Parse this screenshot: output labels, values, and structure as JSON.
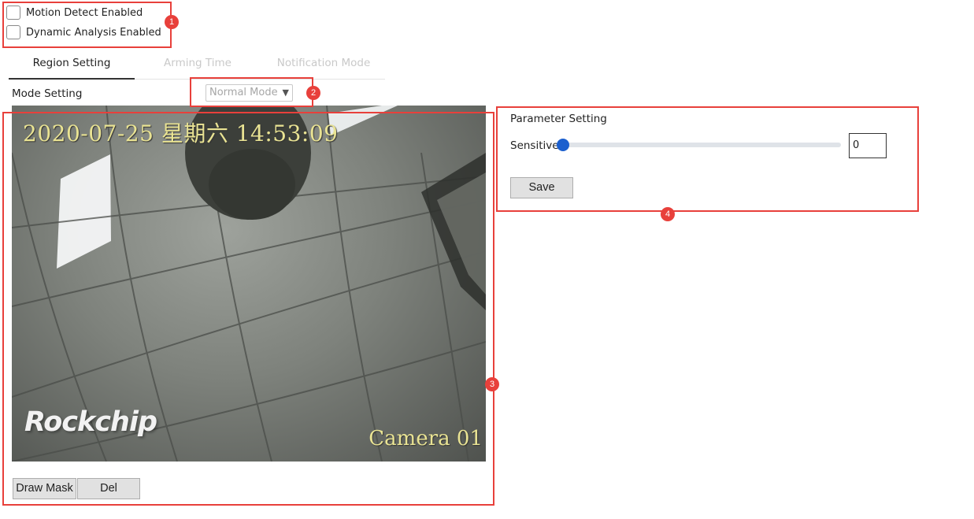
{
  "enable": {
    "motion_detect": {
      "label": "Motion Detect Enabled",
      "checked": false
    },
    "dynamic_analysis": {
      "label": "Dynamic Analysis Enabled",
      "checked": false
    }
  },
  "tabs": [
    {
      "label": "Region Setting",
      "active": true
    },
    {
      "label": "Arming Time",
      "active": false
    },
    {
      "label": "Notification Mode",
      "active": false
    }
  ],
  "mode": {
    "label": "Mode Setting",
    "selected": "Normal Mode"
  },
  "camera": {
    "timestamp": "2020-07-25 星期六 14:53:09",
    "name": "Camera 01",
    "logo": "Rockchip"
  },
  "mask_buttons": {
    "draw": "Draw Mask",
    "del": "Del"
  },
  "parameter": {
    "title": "Parameter Setting",
    "sensitive_label": "Sensitive",
    "sensitive_value": "0",
    "save": "Save"
  },
  "annotations": [
    "1",
    "2",
    "3",
    "4"
  ],
  "colors": {
    "annotation": "#e8403b",
    "slider_thumb": "#1b5fce",
    "overlay_text": "#e9e393"
  }
}
